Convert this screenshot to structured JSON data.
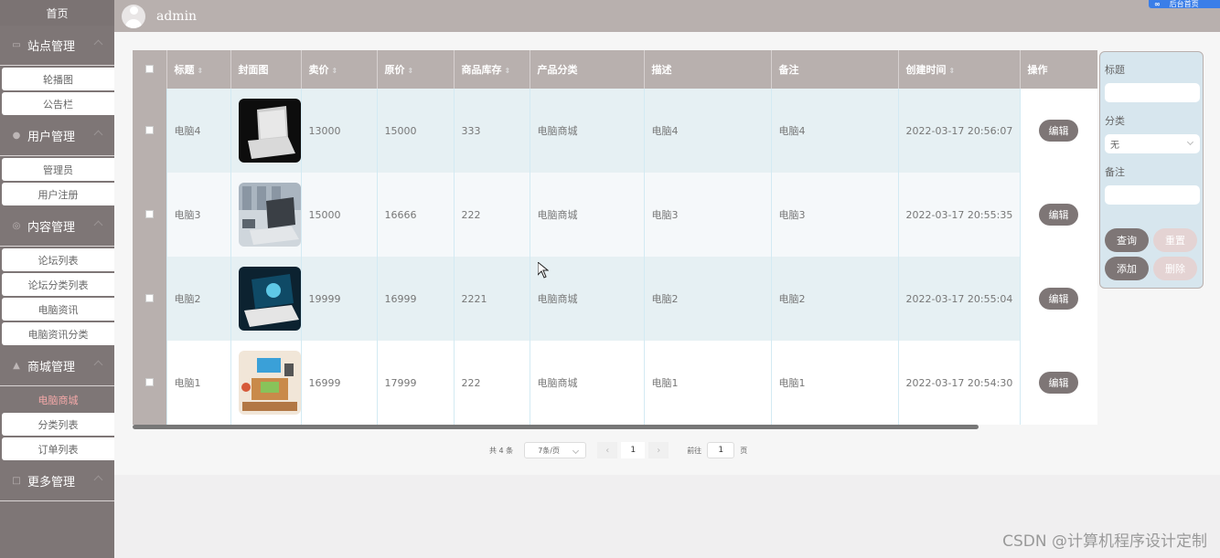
{
  "header": {
    "username": "admin",
    "top_button_left": "∞",
    "top_button_right": "后台首页"
  },
  "sidebar": {
    "home": "首页",
    "groups": [
      {
        "label": "站点管理",
        "icon": "monitor-icon",
        "items": [
          "轮播图",
          "公告栏"
        ]
      },
      {
        "label": "用户管理",
        "icon": "user-icon",
        "items": [
          "管理员",
          "用户注册"
        ]
      },
      {
        "label": "内容管理",
        "icon": "content-icon",
        "items": [
          "论坛列表",
          "论坛分类列表",
          "电脑资讯",
          "电脑资讯分类"
        ]
      },
      {
        "label": "商城管理",
        "icon": "shop-icon",
        "items": [
          "电脑商城",
          "分类列表",
          "订单列表"
        ]
      },
      {
        "label": "更多管理",
        "icon": "more-icon",
        "items": []
      }
    ],
    "active_item": "电脑商城"
  },
  "table": {
    "columns": [
      "标题",
      "封面图",
      "卖价",
      "原价",
      "商品库存",
      "产品分类",
      "描述",
      "备注",
      "创建时间",
      "操作"
    ],
    "rows": [
      {
        "title": "电脑4",
        "price": "13000",
        "original": "15000",
        "stock": "333",
        "category": "电脑商城",
        "desc": "电脑4",
        "note": "电脑4",
        "created": "2022-03-17 20:56:07",
        "action": "编辑"
      },
      {
        "title": "电脑3",
        "price": "15000",
        "original": "16666",
        "stock": "222",
        "category": "电脑商城",
        "desc": "电脑3",
        "note": "电脑3",
        "created": "2022-03-17 20:55:35",
        "action": "编辑"
      },
      {
        "title": "电脑2",
        "price": "19999",
        "original": "16999",
        "stock": "2221",
        "category": "电脑商城",
        "desc": "电脑2",
        "note": "电脑2",
        "created": "2022-03-17 20:55:04",
        "action": "编辑"
      },
      {
        "title": "电脑1",
        "price": "16999",
        "original": "17999",
        "stock": "222",
        "category": "电脑商城",
        "desc": "电脑1",
        "note": "电脑1",
        "created": "2022-03-17 20:54:30",
        "action": "编辑"
      }
    ]
  },
  "pager": {
    "total": "共 4 条",
    "page_size": "7条/页",
    "prev": "‹",
    "current": "1",
    "next": "›",
    "goto": "前往",
    "goto_value": "1",
    "page_unit": "页"
  },
  "search": {
    "title_label": "标题",
    "title_value": "",
    "category_label": "分类",
    "category_value": "无",
    "note_label": "备注",
    "note_value": "",
    "query": "查询",
    "reset": "重置",
    "add": "添加",
    "delete": "删除"
  },
  "watermark": "CSDN @计算机程序设计定制"
}
